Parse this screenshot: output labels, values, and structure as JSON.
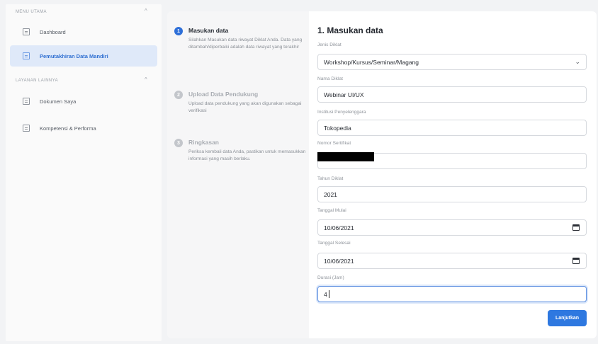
{
  "sidebar": {
    "section_main": "MENU UTAMA",
    "section_other": "LAYANAN LAINNYA",
    "chevron": "^",
    "items": [
      {
        "label": "Dashboard",
        "icon": "dashboard-icon"
      },
      {
        "label": "Pemutakhiran Data Mandiri",
        "icon": "document-list-icon",
        "active": true
      },
      {
        "label": "Dokumen Saya",
        "icon": "folder-icon"
      },
      {
        "label": "Kompetensi & Performa",
        "icon": "grid-icon"
      }
    ]
  },
  "steps": [
    {
      "num": "1",
      "title": "Masukan data",
      "desc": "Silahkan Masukan data riwayat Diklat Anda. Data yang ditambah/diperbaiki adalah data riwayat yang terakhir"
    },
    {
      "num": "2",
      "title": "Upload Data Pendukung",
      "desc": "Upload data pendukung yang akan digunakan sebagai verifikasi"
    },
    {
      "num": "3",
      "title": "Ringkasan",
      "desc": "Periksa kembali data Anda, pastikan untuk memasukkan informasi yang masih berlaku."
    }
  ],
  "form": {
    "title": "1. Masukan data",
    "jenis_label": "Jenis Diklat",
    "jenis_value": "Workshop/Kursus/Seminar/Magang",
    "nama_label": "Nama Diklat",
    "nama_value": "Webinar UI/UX",
    "institusi_label": "Institusi Penyelenggara",
    "institusi_value": "Tokopedia",
    "sertifikat_label": "Nomor Sertifikat",
    "tahun_label": "Tahun Diklat",
    "tahun_value": "2021",
    "mulai_label": "Tanggal Mulai",
    "mulai_value": "10/06/2021",
    "selesai_label": "Tanggal Selesai",
    "selesai_value": "10/06/2021",
    "durasi_label": "Durasi (Jam)",
    "durasi_value": "4",
    "next_label": "Lanjutkan"
  },
  "colors": {
    "accent": "#2e6fd8",
    "active_nav_bg": "#dfe9f9"
  }
}
